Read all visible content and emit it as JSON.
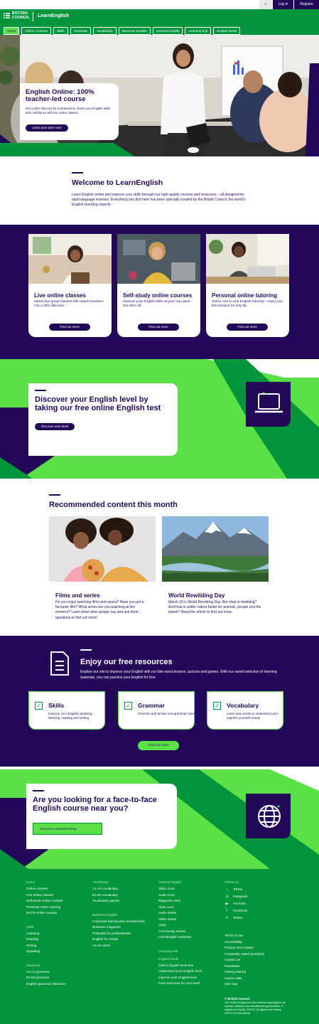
{
  "header": {
    "search_label": "⌕",
    "login": "Log in",
    "register": "Register",
    "logo_line1": "BRITISH",
    "logo_line2": "COUNCIL",
    "site_name": "LearnEnglish"
  },
  "nav": [
    "Home",
    "Online Courses",
    "Skills",
    "Grammar",
    "Vocabulary",
    "Business English",
    "General English",
    "Learning hub",
    "English levels"
  ],
  "hero": {
    "title": "English Online: 100% teacher-led course",
    "text": "Get a 20% discount for a limited time. Boost your English skills and confidence with live online classes.",
    "button": "Learn and save now!"
  },
  "welcome": {
    "title": "Welcome to LearnEnglish",
    "text": "Learn English online and improve your skills through our high-quality courses and resources – all designed for adult language learners. Everything you find here has been specially created by the British Council, the world's English teaching experts."
  },
  "cards": [
    {
      "title": "Live online classes",
      "text": "Interactive group classes with expert teachers. Get a 20% discount.",
      "button": "Find out more"
    },
    {
      "title": "Self-study online courses",
      "text": "Improve your English skills at your own pace. Get 50% off.",
      "button": "Find out more"
    },
    {
      "title": "Personal online tutoring",
      "text": "Online one-to-one English tutoring – enjoy your first session for only $1.",
      "button": "Find out more"
    }
  ],
  "discover": {
    "title": "Discover your English level by taking our free online English test",
    "button": "Discover your level"
  },
  "recommended": {
    "title": "Recommended content this month",
    "items": [
      {
        "title": "Films and series",
        "text": "Do you enjoy watching films and series? Have you got a favourite film? What series are you watching at the moment? Learn what other people say and ask them questions to find out more!"
      },
      {
        "title": "World Rewilding Day",
        "text": "March 20 is World Rewilding Day. But what is rewilding? And how is wilder nature better for animals, people and the planet? Read the article to find out more."
      }
    ]
  },
  "resources": {
    "title": "Enjoy our free resources",
    "text": "Explore our site to improve your English with our bite-sized lessons, quizzes and games. With our varied selection of learning materials, you can practise your English for free.",
    "items": [
      {
        "title": "Skills",
        "text": "Improve your English speaking, listening, reading and writing"
      },
      {
        "title": "Grammar",
        "text": "Practise verb tenses and grammar rules"
      },
      {
        "title": "Vocabulary",
        "text": "Learn new words to understand and express yourself clearly"
      }
    ],
    "button": "Find out more"
  },
  "facetoface": {
    "title": "Are you looking for a face-to-face English course near you?",
    "select": "- Choose a country/territory -"
  },
  "footer": {
    "col1": [
      {
        "head": "Home",
        "links": [
          "Online courses",
          "Live online classes",
          "Self-study online courses",
          "Personal online tutoring",
          "IELTS online courses"
        ]
      },
      {
        "head": "Skills",
        "links": [
          "Listening",
          "Reading",
          "Writing",
          "Speaking"
        ]
      },
      {
        "head": "Grammar",
        "links": [
          "A1-A2 grammar",
          "B1-B2 grammar",
          "English grammar reference"
        ]
      }
    ],
    "col2": [
      {
        "head": "Vocabulary",
        "links": [
          "A1-A2 vocabulary",
          "B1-B2 vocabulary",
          "Vocabulary games"
        ]
      },
      {
        "head": "Business English",
        "links": [
          "Corporate training and assessments",
          "Business magazine",
          "Podcasts for professionals",
          "English for emails",
          "You're Hired"
        ]
      }
    ],
    "col3": [
      {
        "head": "General English",
        "links": [
          "Video zone",
          "Audio zone",
          "Magazine zone",
          "Story zone",
          "Audio series",
          "Video series",
          "Apps",
          "Community events",
          "LearnEnglish webinars"
        ]
      },
      {
        "head": "Learning Hub",
        "links": []
      },
      {
        "head": "English levels",
        "links": [
          "Online English level test",
          "Understand your English level",
          "Improve your English level",
          "Find resources for your level"
        ]
      }
    ],
    "follow_head": "Follow us",
    "social": [
      {
        "icon": "tiktok-icon",
        "glyph": "♪",
        "label": "TikTok"
      },
      {
        "icon": "instagram-icon",
        "glyph": "◎",
        "label": "Instagram"
      },
      {
        "icon": "youtube-icon",
        "glyph": "▶",
        "label": "YouTube"
      },
      {
        "icon": "facebook-icon",
        "glyph": "f",
        "label": "Facebook"
      },
      {
        "icon": "twitter-icon",
        "glyph": "✦",
        "label": "Twitter"
      }
    ],
    "col4_links": [
      "Terms of use",
      "Accessibility",
      "Privacy and cookies",
      "Frequently asked questions",
      "Contact us",
      "Newsletter",
      "Getting started",
      "House rules",
      "Site map"
    ],
    "legal_head": "© British Council",
    "legal_text": "The United Kingdom's international organisation for cultural relations and educational opportunities. A registered charity: 209131 (England and Wales) SC037733 (Scotland)."
  },
  "colors": {
    "green": "#00953b",
    "lime": "#5ce048",
    "purple": "#23085a"
  }
}
